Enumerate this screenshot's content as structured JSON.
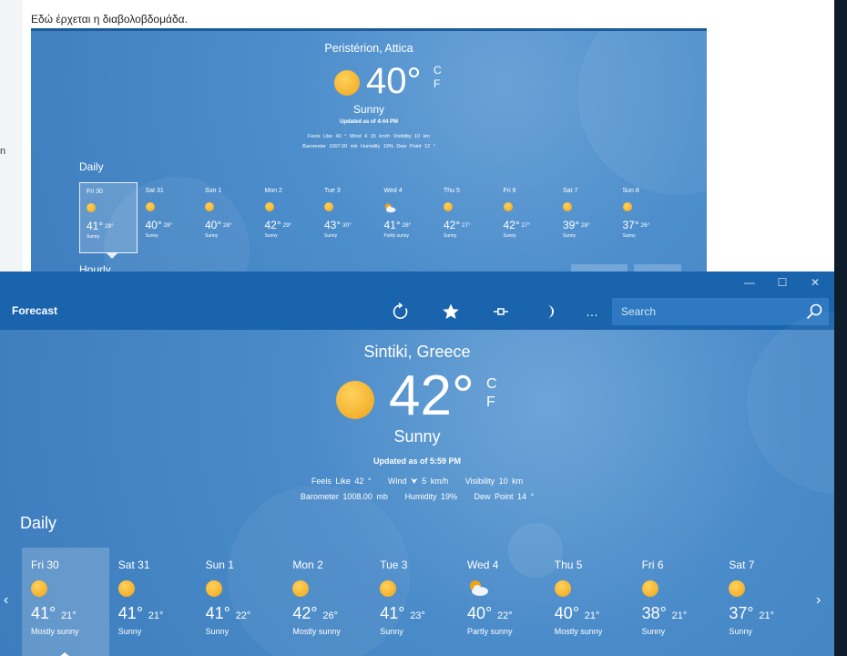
{
  "background": {
    "post_text": "Εδώ έρχεται η διαβολοβδομάδα.",
    "left_fragment": "n"
  },
  "embedded": {
    "location": "Peristérion, Attica",
    "temperature": "40°",
    "unit_c": "C",
    "unit_f": "F",
    "condition": "Sunny",
    "updated": "Updated as of 4:44 PM",
    "details_line1": "Feels Like  40 °     Wind  4  15 km/h     Visibility  10 km",
    "details_line2": "Barometer  1007.00 mb     Humidity  19%     Dew Point  12 °",
    "daily_label": "Daily",
    "hourly_label": "Hourly",
    "days": [
      {
        "name": "Fri 30",
        "hi": "41°",
        "lo": "28°",
        "cond": "Sunny",
        "icon": "sun"
      },
      {
        "name": "Sat 31",
        "hi": "40°",
        "lo": "28°",
        "cond": "Sunny",
        "icon": "sun"
      },
      {
        "name": "Sun 1",
        "hi": "40°",
        "lo": "28°",
        "cond": "Sunny",
        "icon": "sun"
      },
      {
        "name": "Mon 2",
        "hi": "42°",
        "lo": "29°",
        "cond": "Sunny",
        "icon": "sun"
      },
      {
        "name": "Tue 3",
        "hi": "43°",
        "lo": "30°",
        "cond": "Sunny",
        "icon": "sun"
      },
      {
        "name": "Wed 4",
        "hi": "41°",
        "lo": "28°",
        "cond": "Partly sunny",
        "icon": "partly-sunny"
      },
      {
        "name": "Thu 5",
        "hi": "42°",
        "lo": "27°",
        "cond": "Sunny",
        "icon": "sun"
      },
      {
        "name": "Fri 6",
        "hi": "42°",
        "lo": "27°",
        "cond": "Sunny",
        "icon": "sun"
      },
      {
        "name": "Sat 7",
        "hi": "39°",
        "lo": "28°",
        "cond": "Sunny",
        "icon": "sun"
      },
      {
        "name": "Sun 8",
        "hi": "37°",
        "lo": "26°",
        "cond": "Sunny",
        "icon": "sun"
      }
    ]
  },
  "window": {
    "title": "Forecast",
    "controls": {
      "minimize": "—",
      "maximize": "☐",
      "close": "✕"
    },
    "toolbar_icons": [
      "refresh-icon",
      "favorite-star-icon",
      "pin-icon",
      "dark-mode-moon-icon",
      "more-icon"
    ],
    "more_label": "…",
    "search_placeholder": "Search"
  },
  "current": {
    "location": "Sintiki, Greece",
    "temperature": "42°",
    "unit_c": "C",
    "unit_f": "F",
    "condition": "Sunny",
    "updated": "Updated as of 5:59 PM",
    "feels_like": "Feels Like  42 °",
    "wind": "Wind  ⮟ 5 km/h",
    "visibility": "Visibility  10 km",
    "barometer": "Barometer  1008.00 mb",
    "humidity": "Humidity  19%",
    "dew_point": "Dew Point  14 °"
  },
  "daily": {
    "heading": "Daily",
    "prev_arrow": "‹",
    "next_arrow": "›",
    "days": [
      {
        "name": "Fri 30",
        "hi": "41°",
        "lo": "21°",
        "cond": "Mostly sunny",
        "icon": "sun"
      },
      {
        "name": "Sat 31",
        "hi": "41°",
        "lo": "21°",
        "cond": "Sunny",
        "icon": "sun"
      },
      {
        "name": "Sun 1",
        "hi": "41°",
        "lo": "22°",
        "cond": "Sunny",
        "icon": "sun"
      },
      {
        "name": "Mon 2",
        "hi": "42°",
        "lo": "26°",
        "cond": "Mostly sunny",
        "icon": "sun"
      },
      {
        "name": "Tue 3",
        "hi": "41°",
        "lo": "23°",
        "cond": "Sunny",
        "icon": "sun"
      },
      {
        "name": "Wed 4",
        "hi": "40°",
        "lo": "22°",
        "cond": "Partly sunny",
        "icon": "partly-sunny"
      },
      {
        "name": "Thu 5",
        "hi": "40°",
        "lo": "21°",
        "cond": "Mostly sunny",
        "icon": "sun"
      },
      {
        "name": "Fri 6",
        "hi": "38°",
        "lo": "21°",
        "cond": "Sunny",
        "icon": "sun"
      },
      {
        "name": "Sat 7",
        "hi": "37°",
        "lo": "21°",
        "cond": "Sunny",
        "icon": "sun"
      }
    ]
  },
  "colors": {
    "titlebar": "#1a63ad",
    "content": "#3e85c7",
    "sun": "#f0a219"
  }
}
